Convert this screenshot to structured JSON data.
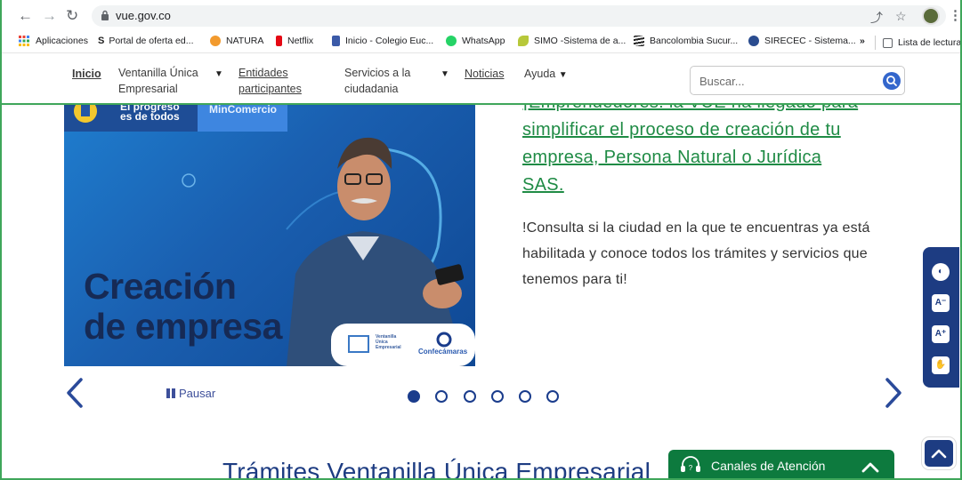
{
  "browser": {
    "url": "vue.gov.co",
    "bookmarks": [
      {
        "label": "Aplicaciones",
        "color": "#ea4335"
      },
      {
        "label": "Portal de oferta ed...",
        "color": "#222222"
      },
      {
        "label": "NATURA",
        "color": "#f29a2e"
      },
      {
        "label": "Netflix",
        "color": "#e50914"
      },
      {
        "label": "Inicio - Colegio Euc...",
        "color": "#3b5aa8"
      },
      {
        "label": "WhatsApp",
        "color": "#25d366"
      },
      {
        "label": "SIMO -Sistema de a...",
        "color": "#b7c83a"
      },
      {
        "label": "Bancolombia Sucur...",
        "color": "#222222"
      },
      {
        "label": "SIRECEC - Sistema...",
        "color": "#2a4c8f"
      }
    ],
    "overflow_label": "»",
    "reading_list": "Lista de lectura"
  },
  "nav": {
    "inicio": "Inicio",
    "ventanilla_line1": "Ventanilla Única",
    "ventanilla_line2": "Empresarial",
    "entidades_line1": "Entidades",
    "entidades_line2": "participantes",
    "servicios_line1": "Servicios a la",
    "servicios_line2": "ciudadania",
    "noticias": "Noticias",
    "ayuda": "Ayuda",
    "search_placeholder": "Buscar..."
  },
  "hero": {
    "banner_progreso_line1": "El progreso",
    "banner_progreso_line2": "es de todos",
    "banner_mincomercio": "MinComercio",
    "headline_line1": "Creación",
    "headline_line2": "de empresa",
    "logo_vue_line1": "Ventanilla",
    "logo_vue_line2": "Única",
    "logo_vue_line3": "Empresarial",
    "logo_confecamaras": "Confecámaras",
    "link_line1": "¡Emprendedores: la VUE ha llegado para",
    "link_line2": "simplificar el proceso de creación de tu",
    "link_line3": "empresa, Persona Natural o Jurídica",
    "link_line4": "SAS.",
    "body": "!Consulta si la ciudad en la que te encuentras ya está habilitada y conoce todos los trámites y servicios que tenemos para ti!"
  },
  "carousel": {
    "pause_label": "Pausar",
    "slide_count": 6,
    "active_index": 0
  },
  "section": {
    "title": "Trámites Ventanilla Única Empresarial"
  },
  "canales": {
    "label": "Canales de Atención"
  },
  "colors": {
    "brand_green": "#1f8b45",
    "brand_blue": "#1d3c82",
    "canales_green": "#0d7a3e"
  }
}
